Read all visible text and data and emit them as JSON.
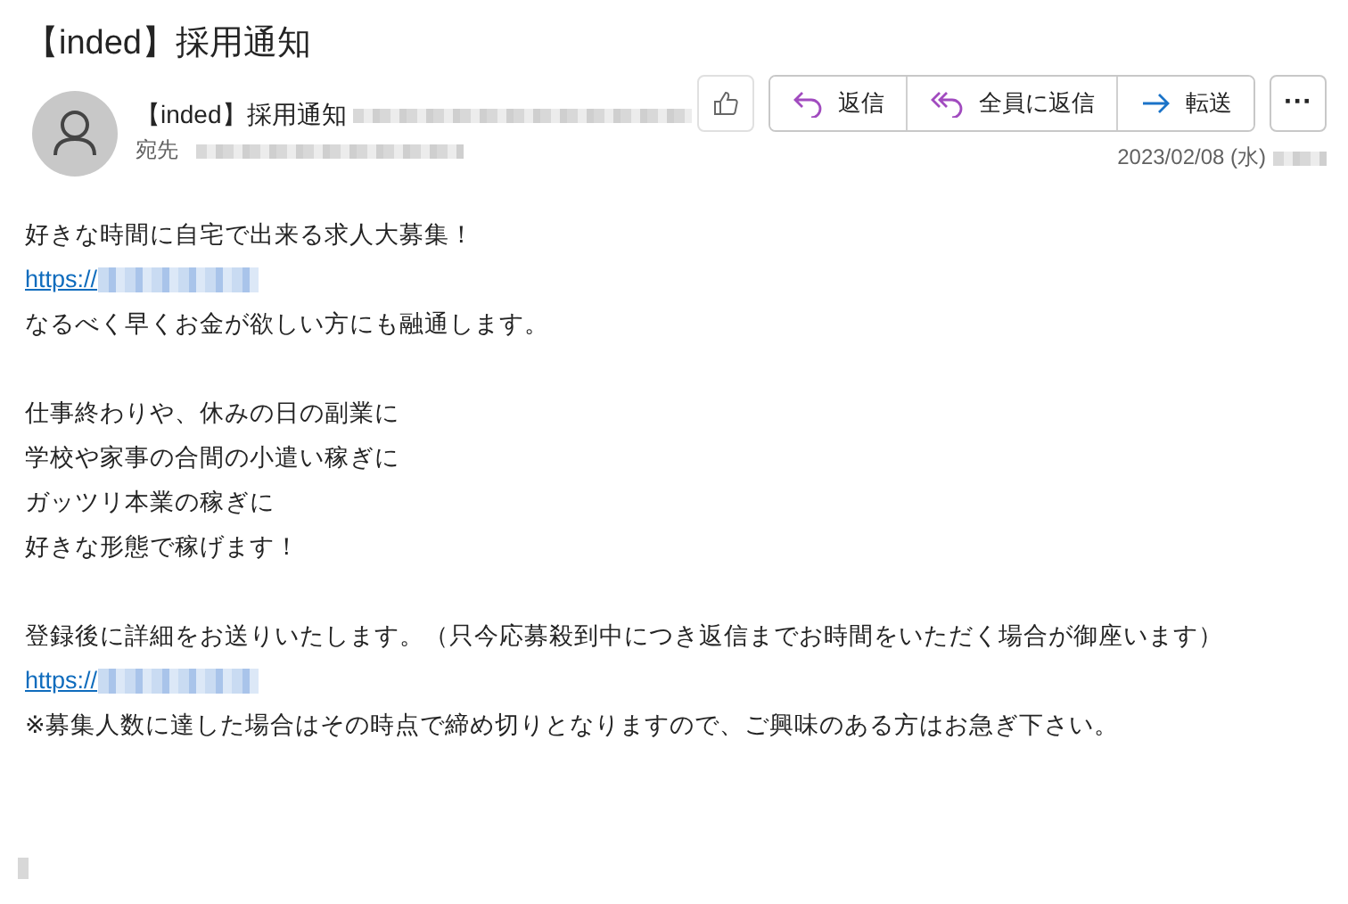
{
  "subject": "【inded】採用通知",
  "sender": {
    "name": "【inded】採用通知",
    "to_label": "宛先"
  },
  "actions": [
    {
      "kind": "reply",
      "label": "返信"
    },
    {
      "kind": "reply_all",
      "label": "全員に返信"
    },
    {
      "kind": "forward",
      "label": "転送"
    }
  ],
  "more": "···",
  "date": "2023/02/08 (水)",
  "body": [
    {
      "kind": "text",
      "text": "好きな時間に自宅で出来る求人大募集！"
    },
    {
      "kind": "link",
      "text": "https://"
    },
    {
      "kind": "text",
      "text": "なるべく早くお金が欲しい方にも融通します。"
    },
    {
      "kind": "blank"
    },
    {
      "kind": "text",
      "text": "仕事終わりや、休みの日の副業に"
    },
    {
      "kind": "text",
      "text": "学校や家事の合間の小遣い稼ぎに"
    },
    {
      "kind": "text",
      "text": "ガッツリ本業の稼ぎに"
    },
    {
      "kind": "text",
      "text": "好きな形態で稼げます！"
    },
    {
      "kind": "blank"
    },
    {
      "kind": "text",
      "text": "登録後に詳細をお送りいたします。（只今応募殺到中につき返信までお時間をいただく場合が御座います）"
    },
    {
      "kind": "link",
      "text": "https://"
    },
    {
      "kind": "text",
      "text": "※募集人数に達した場合はその時点で締め切りとなりますので、ご興味のある方はお急ぎ下さい。"
    }
  ]
}
